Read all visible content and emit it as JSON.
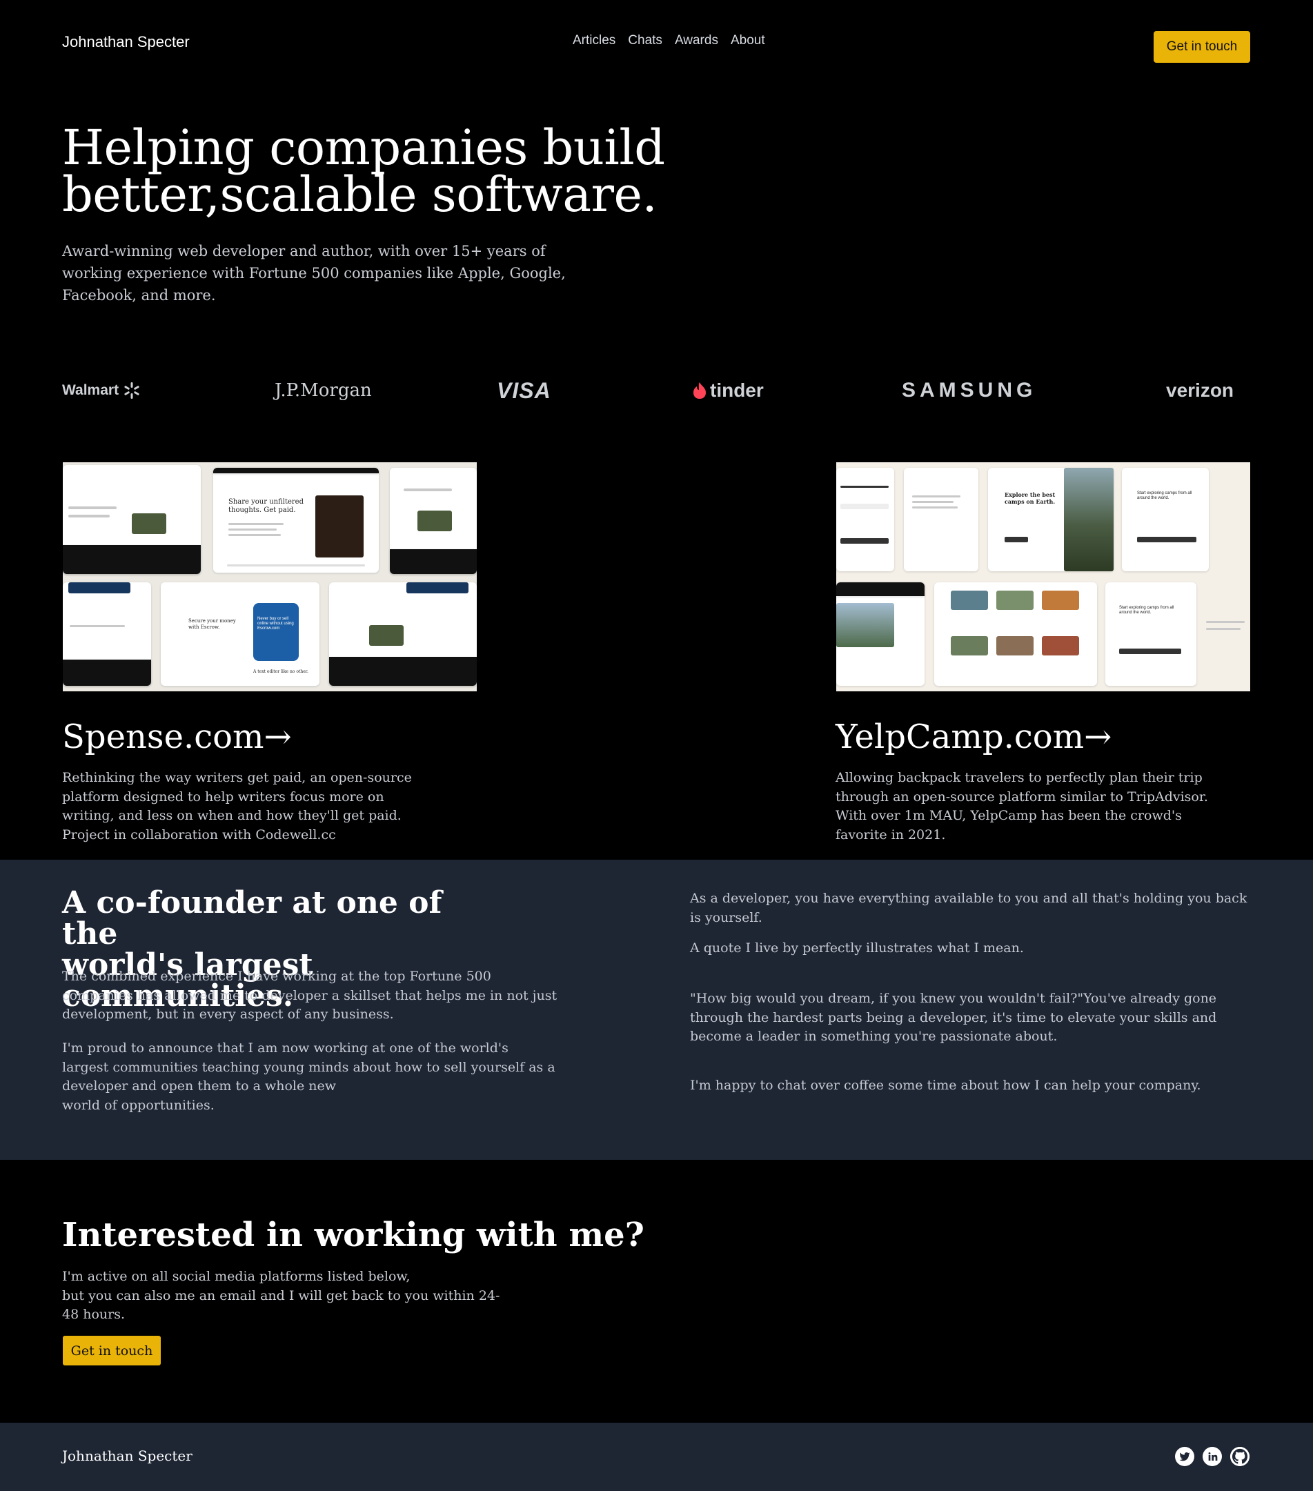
{
  "header": {
    "brand": "Johnathan Specter",
    "nav": [
      "Articles",
      "Chats",
      "Awards",
      "About"
    ],
    "cta": "Get in touch"
  },
  "hero": {
    "title_line1": "Helping companies build",
    "title_line2": "better,scalable software.",
    "subtitle": "Award-winning web developer and author, with over 15+ years of working experience with Fortune 500 companies like Apple, Google, Facebook, and more."
  },
  "clients": {
    "logos": [
      "Walmart",
      "J.P.Morgan",
      "VISA",
      "tinder",
      "SAMSUNG",
      "verizon"
    ]
  },
  "projects": [
    {
      "title": "Spense.com→",
      "description": "Rethinking the way writers get paid, an open-source platform designed to help writers focus more on writing, and less on when and how they'll get paid. Project in collaboration with Codewell.cc",
      "shot_text": {
        "heading": "Share your unfiltered thoughts. Get paid.",
        "card_a": "Secure your money with Escrow.",
        "card_b": "Never buy or sell online without using Escrow.com",
        "card_c": "A text editor like no other."
      }
    },
    {
      "title": "YelpCamp.com→",
      "description": "Allowing backpack travelers to perfectly plan their trip through an open-source platform similar to TripAdvisor. With over 1m MAU, YelpCamp has been the crowd's favorite in 2021.",
      "shot_text": {
        "heading": "Explore the best camps on Earth.",
        "card_a": "Start exploring camps from all around the world.",
        "card_b": "Start exploring camps from all around the world."
      }
    }
  ],
  "about": {
    "title_line1": "A co-founder at one of the",
    "title_line2": "world's largest communities.",
    "left_p1": "The combined experience I have working at the top Fortune 500 companies has allowed me to developer a skillset that helps me in not just development, but in every aspect of any business.",
    "left_p2a": "I'm proud to announce that I am now working at one of the world's largest communities teaching young minds about how to sell yourself as a developer and open them to a whole new",
    "left_p2b": "world of opportunities.",
    "right_p1": "As a developer, you have everything available to you and all that's holding you back is yourself.",
    "right_p2": "A quote I live by perfectly illustrates what I mean.",
    "right_p3": "\"How big would you dream, if you knew you wouldn't fail?\"You've already gone through the hardest parts being a developer, it's time to elevate your skills and become a leader in something you're passionate about.",
    "right_p4": "I'm happy to chat over coffee some time about how I can help your company."
  },
  "contact": {
    "title": "Interested in working with me?",
    "line1": "I'm active on all social media platforms listed below,",
    "line2": "but you can also me an email and I will get back to you within 24-48 hours.",
    "cta": "Get in touch"
  },
  "footer": {
    "name": "Johnathan Specter",
    "social_icons": [
      "twitter-icon",
      "linkedin-icon",
      "github-icon"
    ]
  },
  "colors": {
    "background": "#000000",
    "band": "#1e2533",
    "accent": "#eab308",
    "text_muted": "#c9ccd3"
  }
}
